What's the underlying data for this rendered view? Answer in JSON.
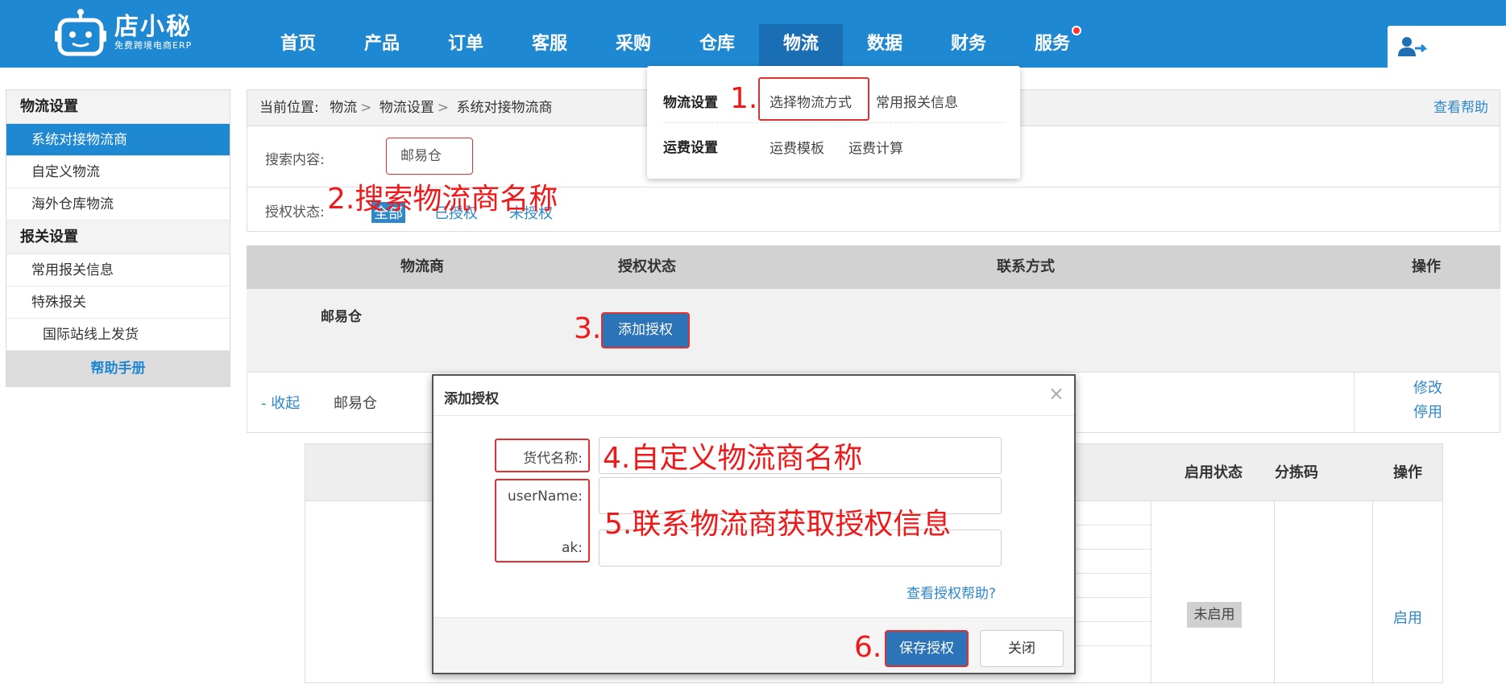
{
  "app": {
    "logo_name": "店小秘",
    "logo_sub": "免费跨境电商ERP"
  },
  "nav": {
    "items": [
      "首页",
      "产品",
      "订单",
      "客服",
      "采购",
      "仓库",
      "物流",
      "数据",
      "财务",
      "服务"
    ],
    "active": "物流"
  },
  "dropdown": {
    "group1_label": "物流设置",
    "group1_links": [
      "选择物流方式",
      "常用报关信息"
    ],
    "group2_label": "运费设置",
    "group2_links": [
      "运费模板",
      "运费计算"
    ]
  },
  "sidebar": {
    "group1": "物流设置",
    "items1": [
      "系统对接物流商",
      "自定义物流",
      "海外仓库物流"
    ],
    "group2": "报关设置",
    "items2": [
      "常用报关信息",
      "特殊报关"
    ],
    "sub_item": "国际站线上发货",
    "help": "帮助手册"
  },
  "breadcrumb": {
    "prefix": "当前位置:",
    "parts": [
      "物流",
      "物流设置",
      "系统对接物流商"
    ],
    "help": "查看帮助"
  },
  "search": {
    "label": "搜索内容:",
    "value": "邮易仓",
    "auth_label": "授权状态:",
    "auth_options": [
      "全部",
      "已授权",
      "未授权"
    ]
  },
  "table": {
    "headers": [
      "物流商",
      "授权状态",
      "联系方式",
      "操作"
    ],
    "row1_name": "邮易仓",
    "add_button": "添加授权",
    "row2_collapse": "- 收起",
    "row2_name": "邮易仓",
    "row2_ops": [
      "修改",
      "停用"
    ],
    "inner_headers": [
      "启用状态",
      "分拣码",
      "操作"
    ],
    "status_tag": "未启用",
    "enable_link": "启用"
  },
  "modal": {
    "title": "添加授权",
    "close": "×",
    "fields": [
      "货代名称:",
      "userName:",
      "ak:"
    ],
    "help_link": "查看授权帮助?",
    "save_button": "保存授权",
    "close_button": "关闭"
  },
  "annotations": {
    "a1": "1.",
    "a2": "2.搜索物流商名称",
    "a3": "3.",
    "a4": "4.自定义物流商名称",
    "a5": "5.联系物流商获取授权信息",
    "a6": "6."
  },
  "colors": {
    "brand_blue": "#1e88d2",
    "annotation_red": "#f01818"
  }
}
